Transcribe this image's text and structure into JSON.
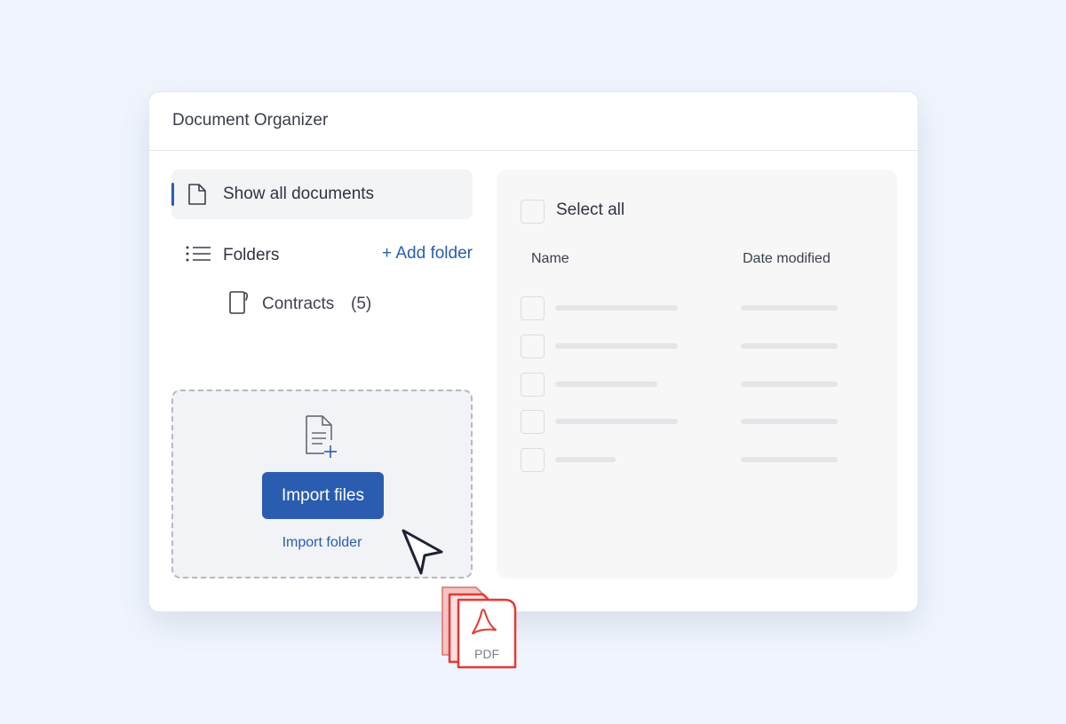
{
  "window": {
    "title": "Document Organizer"
  },
  "sidebar": {
    "show_all_label": "Show all documents",
    "folders_label": "Folders",
    "add_folder_label": "+ Add folder",
    "folders": [
      {
        "label": "Contracts",
        "count": "(5)"
      }
    ]
  },
  "import": {
    "button_label": "Import files",
    "folder_link_label": "Import folder"
  },
  "table": {
    "select_all_label": "Select all",
    "columns": [
      "Name",
      "Date modified"
    ],
    "rows": 5
  },
  "drag_item": {
    "file_type_label": "PDF"
  },
  "colors": {
    "accent": "#2a5db0",
    "pdf_red": "#e53935",
    "background": "#f0f5fd"
  },
  "icons": [
    "document-icon",
    "list-icon",
    "folder-icon",
    "file-add-icon",
    "mouse-cursor-icon",
    "pdf-icon"
  ]
}
